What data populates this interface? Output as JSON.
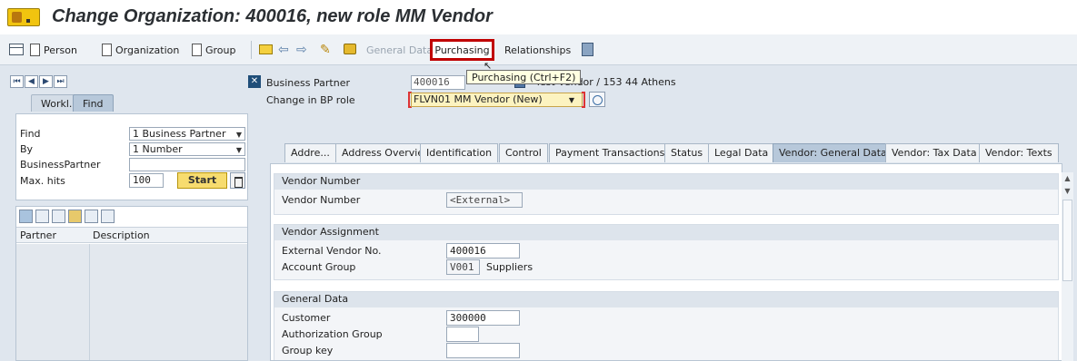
{
  "title": "Change Organization: 400016, new role MM Vendor",
  "toolbar": {
    "person": "Person",
    "organization": "Organization",
    "group": "Group",
    "general_data": "General Data",
    "purchasing": "Purchasing",
    "relationships": "Relationships"
  },
  "tooltip": "Purchasing   (Ctrl+F2)",
  "left_panel": {
    "tabs": [
      "Workl...",
      "Find"
    ],
    "find_label": "Find",
    "find_value": "1 Business Partner",
    "by_label": "By",
    "by_value": "1 Number",
    "bp_label": "BusinessPartner",
    "bp_value": "",
    "maxhits_label": "Max. hits",
    "maxhits_value": "100",
    "start": "Start",
    "columns": [
      "Partner",
      "Description"
    ]
  },
  "header": {
    "bp_label": "Business Partner",
    "bp_value": "400016",
    "bp_desc": "Test Vendor / 153 44 Athens",
    "role_label": "Change in BP role",
    "role_value": "FLVN01 MM Vendor (New)"
  },
  "tabs": [
    "Addre...",
    "Address Overview",
    "Identification",
    "Control",
    "Payment Transactions",
    "Status",
    "Legal Data",
    "Vendor: General Data",
    "Vendor: Tax Data",
    "Vendor: Texts"
  ],
  "active_tab": "Vendor: General Data",
  "groups": {
    "vendor_number": {
      "title": "Vendor Number",
      "label": "Vendor Number",
      "value": "<External>"
    },
    "vendor_assignment": {
      "title": "Vendor Assignment",
      "ext_label": "External Vendor No.",
      "ext_value": "400016",
      "acct_label": "Account Group",
      "acct_value": "V001",
      "acct_desc": "Suppliers"
    },
    "general_data": {
      "title": "General Data",
      "customer_label": "Customer",
      "customer_value": "300000",
      "auth_label": "Authorization Group",
      "auth_value": "",
      "group_label": "Group key",
      "group_value": ""
    }
  }
}
